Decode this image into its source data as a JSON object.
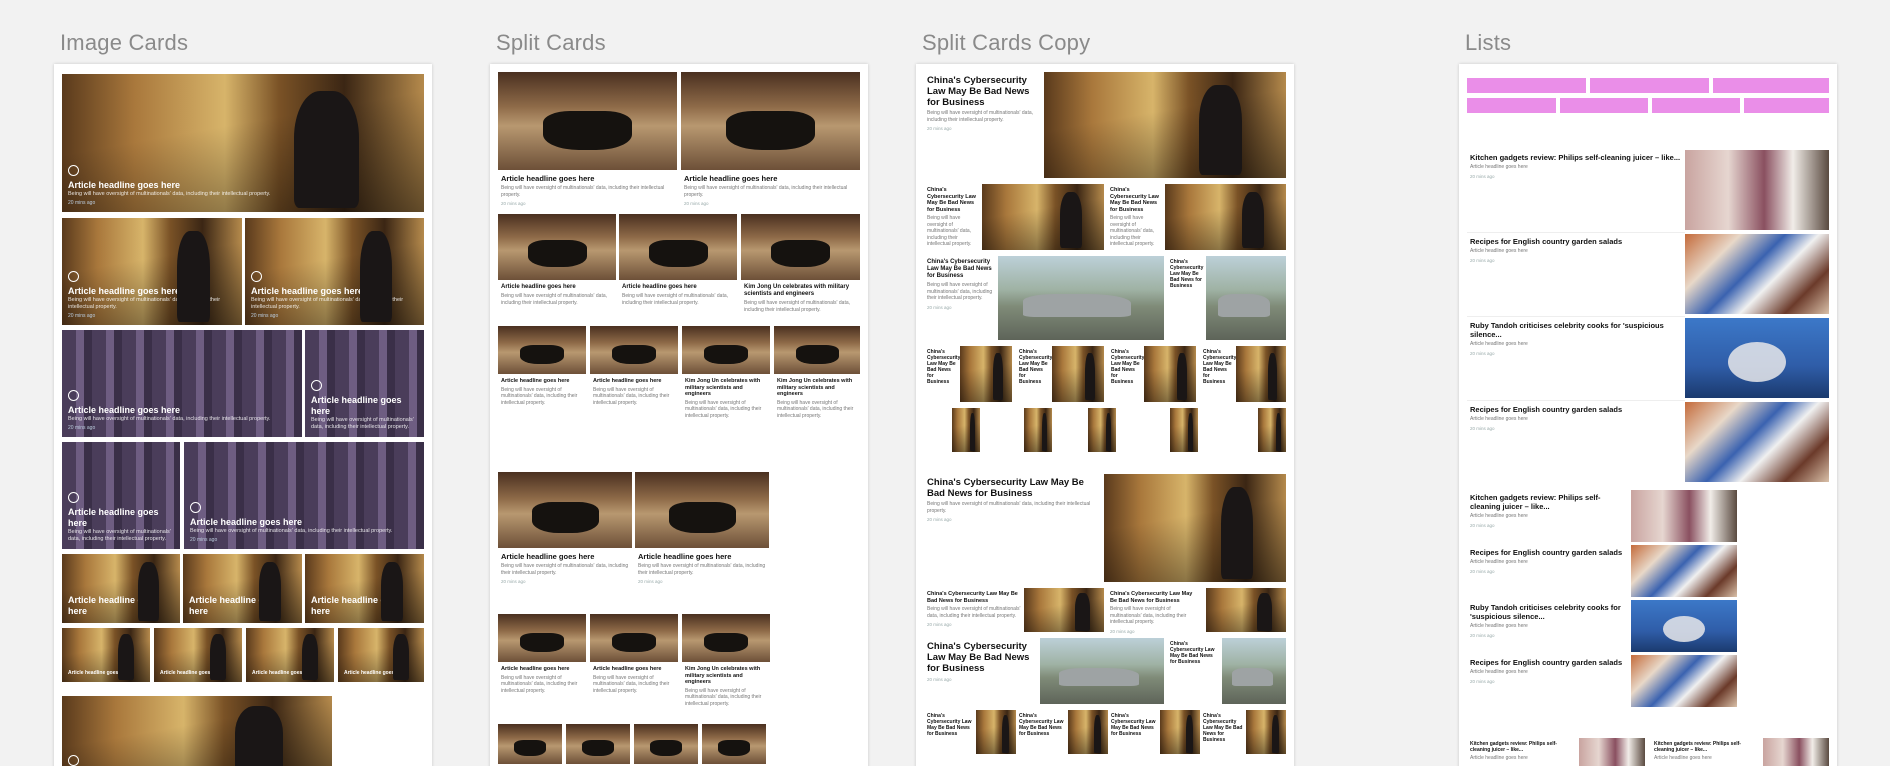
{
  "frames": {
    "image_cards": "Image Cards",
    "split_cards": "Split Cards",
    "split_cards_copy": "Split Cards Copy",
    "lists": "Lists"
  },
  "cards": {
    "headline": "Article headline goes here",
    "sub": "Being will have oversight of multinationals' data, including their intellectual property.",
    "time": "20 mins ago",
    "kim": "Kim Jong Un celebrates with military scientists and engineers",
    "china": "China's Cybersecurity Law May Be Bad News for Business"
  },
  "lists": {
    "juicer": "Kitchen gadgets review: Philips self-cleaning juicer – like...",
    "salads": "Recipes for English country garden salads",
    "tandoh": "Ruby Tandoh criticises celebrity cooks for 'suspicious silence...",
    "sub": "Article headline goes here",
    "time": "20 mins ago"
  }
}
